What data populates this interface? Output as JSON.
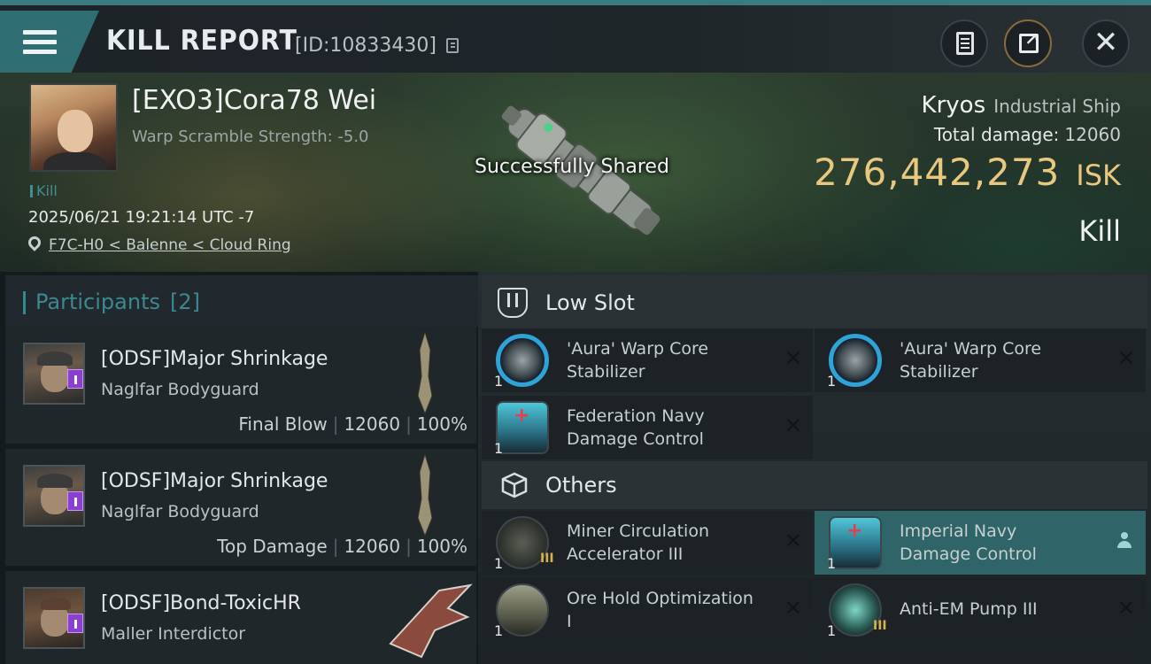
{
  "header": {
    "title": "KILL REPORT",
    "report_id": "[ID:10833430]"
  },
  "victim": {
    "name": "[EXO3]Cora78 Wei",
    "warp_scramble": "Warp Scramble Strength: -5.0",
    "result_tag": "Kill",
    "datetime": "2025/06/21 19:21:14 UTC -7",
    "location": "F7C-H0 < Balenne < Cloud Ring",
    "ship_name": "Kryos",
    "ship_class": "Industrial Ship",
    "total_damage_label": "Total damage:",
    "total_damage": "12060",
    "isk_value": "276,442,273",
    "isk_unit": "ISK",
    "outcome": "Kill"
  },
  "toast": {
    "message": "Successfully Shared"
  },
  "participants": {
    "title": "Participants",
    "count": "[2]",
    "rows": [
      {
        "name": "[ODSF]Major Shrinkage",
        "ship": "Naglfar Bodyguard",
        "role": "Final Blow",
        "damage": "12060",
        "percent": "100%"
      },
      {
        "name": "[ODSF]Major Shrinkage",
        "ship": "Naglfar Bodyguard",
        "role": "Top Damage",
        "damage": "12060",
        "percent": "100%"
      },
      {
        "name": "[ODSF]Bond-ToxicHR",
        "ship": "Maller Interdictor"
      }
    ]
  },
  "sections": {
    "low_slot": "Low Slot",
    "others": "Others"
  },
  "modules": {
    "low": [
      {
        "line1": "'Aura' Warp Core",
        "line2": "Stabilizer",
        "qty": "1"
      },
      {
        "line1": "'Aura' Warp Core",
        "line2": "Stabilizer",
        "qty": "1"
      },
      {
        "line1": "Federation Navy",
        "line2": "Damage Control",
        "qty": "1"
      }
    ],
    "others": [
      {
        "line1": "Miner Circulation",
        "line2": "Accelerator III",
        "qty": "1",
        "tier": "III"
      },
      {
        "line1": "Imperial Navy",
        "line2": "Damage Control",
        "qty": "1"
      },
      {
        "line1": "Ore Hold Optimization",
        "line2": "I",
        "qty": "1"
      },
      {
        "line1": "Anti-EM Pump III",
        "qty": "1",
        "tier": "III"
      }
    ]
  },
  "colors": {
    "accent_teal": "#2f6e73",
    "isk_gold": "#e8c77e",
    "badge_purple": "#8a3fd0",
    "stabilizer_blue": "#2fa2d8"
  }
}
